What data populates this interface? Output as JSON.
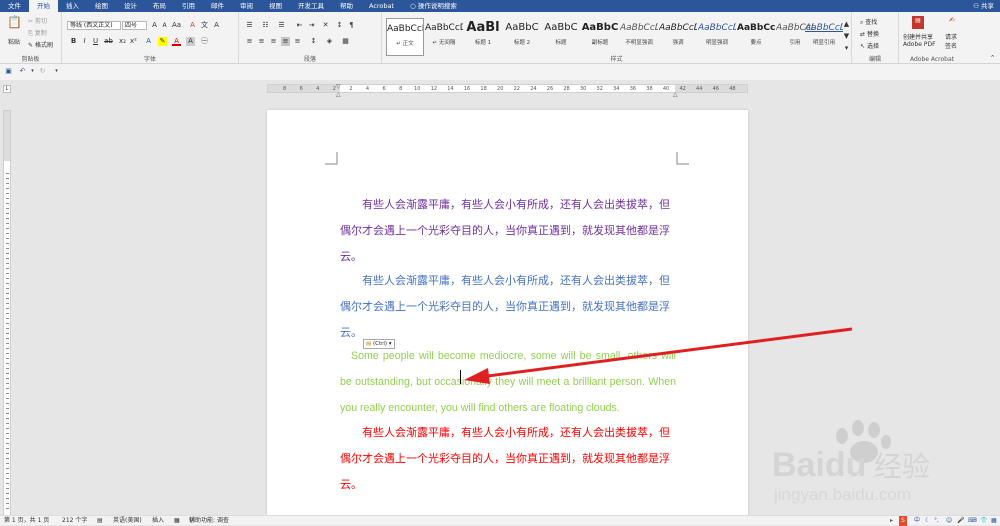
{
  "menu": {
    "tabs": [
      "文件",
      "开始",
      "插入",
      "绘图",
      "设计",
      "布局",
      "引用",
      "邮件",
      "审阅",
      "视图",
      "开发工具",
      "帮助",
      "Acrobat"
    ],
    "search": "操作说明搜索",
    "share": "共享"
  },
  "clipboard": {
    "paste": "粘贴",
    "cut": "剪切",
    "copy": "复制",
    "format_painter": "格式刷",
    "label": "剪贴板"
  },
  "font": {
    "name": "等线 (西文正文)",
    "size": "四号",
    "label": "字体"
  },
  "paragraph": {
    "label": "段落"
  },
  "styles": {
    "label": "样式",
    "items": [
      {
        "preview": "AaBbCcDd",
        "name": "↵ 正文"
      },
      {
        "preview": "AaBbCcDd",
        "name": "↵ 无间隔"
      },
      {
        "preview": "AaBl",
        "name": "标题 1"
      },
      {
        "preview": "AaBbC",
        "name": "标题 2"
      },
      {
        "preview": "AaBbC",
        "name": "标题"
      },
      {
        "preview": "AaBbC",
        "name": "副标题"
      },
      {
        "preview": "AaBbCcDd",
        "name": "不明显强调"
      },
      {
        "preview": "AaBbCcDd",
        "name": "强调"
      },
      {
        "preview": "AaBbCcDd",
        "name": "明显强调"
      },
      {
        "preview": "AaBbCcDd",
        "name": "要点"
      },
      {
        "preview": "AaBbCcDd",
        "name": "引用"
      },
      {
        "preview": "AaBbCcDd",
        "name": "明显引用"
      }
    ]
  },
  "editing": {
    "find": "查找",
    "replace": "替换",
    "select": "选择",
    "label": "编辑"
  },
  "acrobat": {
    "create_share": "创建并共享",
    "adobe_pdf": "Adobe PDF",
    "request": "请求",
    "sign": "签名",
    "label": "Adobe Acrobat"
  },
  "ruler": {
    "ticks": [
      "8",
      "6",
      "4",
      "2",
      "2",
      "4",
      "6",
      "8",
      "10",
      "12",
      "14",
      "16",
      "18",
      "20",
      "22",
      "24",
      "26",
      "28",
      "30",
      "32",
      "34",
      "36",
      "38",
      "40",
      "42",
      "44",
      "46",
      "48"
    ]
  },
  "document": {
    "paragraphs": [
      {
        "text": "有些人会渐露平庸，有些人会小有所成，还有人会出类拔萃，但偶尔才会遇上一个光彩夺目的人，当你真正遇到，就发现其他都是浮云。",
        "color": "#7030a0"
      },
      {
        "text": "有些人会渐露平庸，有些人会小有所成，还有人会出类拔萃，但偶尔才会遇上一个光彩夺目的人，当你真正遇到，就发现其他都是浮云。",
        "color": "#4472c4"
      },
      {
        "text": "Some people will become mediocre, some will be small, others will be outstanding, but occasionally they will meet a brilliant person. When you really encounter, you will find others are floating clouds.",
        "color": "#92d050"
      },
      {
        "text": "有些人会渐露平庸，有些人会小有所成，还有人会出类拔萃，但偶尔才会遇上一个光彩夺目的人，当你真正遇到，就发现其他都是浮云。",
        "color": "#ff0000"
      }
    ],
    "paste_options": "(Ctrl)"
  },
  "status": {
    "page": "第 1 页，共 1 页",
    "words": "212 个字",
    "language": "英语(美国)",
    "mode": "插入",
    "accessibility": "辅助功能: 调查"
  },
  "watermark": {
    "brand": "Baidu",
    "brand_cn": "经验",
    "url": "jingyan.baidu.com"
  },
  "ime": {
    "label": "中"
  }
}
